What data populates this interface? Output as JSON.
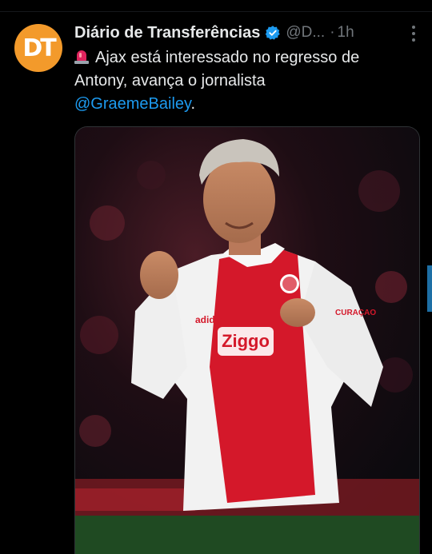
{
  "tweet": {
    "avatar_text": "DT",
    "author_name": "Diário de Transferências",
    "handle": "@D...",
    "separator": "·",
    "time": "1h",
    "text_line1": "Ajax está interessado no regresso de",
    "text_line2": "Antony, avança o jornalista",
    "mention": "@GraemeBailey",
    "mention_suffix": "."
  },
  "colors": {
    "background": "#000000",
    "text": "#e7e9ea",
    "secondary": "#71767b",
    "link": "#1d9bf0",
    "avatar": "#f39a2b",
    "verified": "#1d9bf0"
  },
  "media": {
    "jersey_sponsor": "Ziggo",
    "kit_brand": "adidas",
    "sleeve_text": "CURAÇAO"
  }
}
